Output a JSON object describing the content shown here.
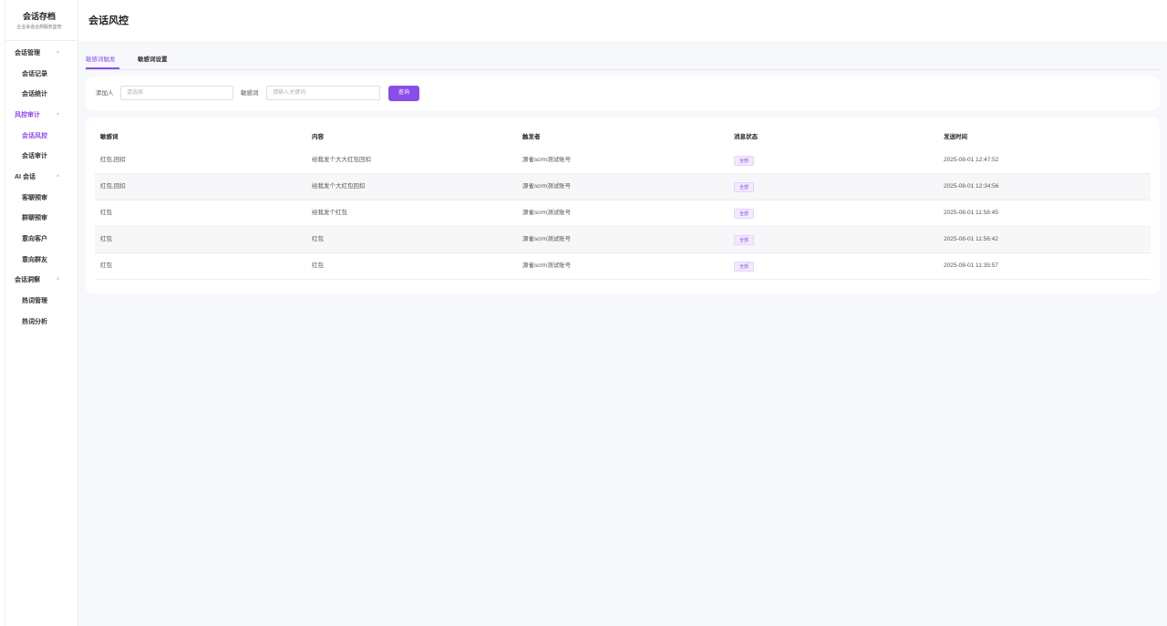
{
  "app": {
    "brand_title": "会话存档",
    "brand_subtitle": "企业会话合规服务监管"
  },
  "sidebar": {
    "groups": [
      {
        "label": "会话管理",
        "chevron": "^",
        "active": false
      },
      {
        "label": "风控审计",
        "chevron": "^",
        "active": true
      },
      {
        "label": "AI 会话",
        "chevron": "^",
        "active": false
      },
      {
        "label": "会话洞察",
        "chevron": "^",
        "active": false
      }
    ],
    "items": [
      {
        "label": "会话记录"
      },
      {
        "label": "会话统计"
      },
      {
        "label": "会话风控",
        "active": true
      },
      {
        "label": "会话审计"
      },
      {
        "label": "客聊预审"
      },
      {
        "label": "群聊预审"
      },
      {
        "label": "意向客户"
      },
      {
        "label": "意向群友"
      },
      {
        "label": "热词管理"
      },
      {
        "label": "热词分析"
      }
    ]
  },
  "header": {
    "title": "会话风控"
  },
  "tabs": [
    {
      "label": "敏感词触发",
      "active": true
    },
    {
      "label": "敏感词设置",
      "active": false
    }
  ],
  "filters": {
    "adder_label": "添加人",
    "adder_placeholder": "请选择",
    "keyword_label": "敏感词",
    "keyword_placeholder": "请输入关键词",
    "query_button": "查询"
  },
  "table": {
    "columns": [
      "敏感词",
      "内容",
      "触发者",
      "消息状态",
      "发送时间"
    ],
    "rows": [
      {
        "word": "红包,回扣",
        "content": "给我发个大大红包回扣",
        "sender": "源雀scrm测试账号",
        "status": "全部",
        "time": "2025-08-01 12:47:52"
      },
      {
        "word": "红包,回扣",
        "content": "给我发个大红包回扣",
        "sender": "源雀scrm测试账号",
        "status": "全部",
        "time": "2025-08-01 12:34:56"
      },
      {
        "word": "红包",
        "content": "给我发个红包",
        "sender": "源雀scrm测试账号",
        "status": "全部",
        "time": "2025-08-01 11:58:45"
      },
      {
        "word": "红包",
        "content": "红包",
        "sender": "源雀scrm测试账号",
        "status": "全部",
        "time": "2025-08-01 11:56:42"
      },
      {
        "word": "红包",
        "content": "红包",
        "sender": "源雀scrm测试账号",
        "status": "全部",
        "time": "2025-08-01 11:35:57"
      }
    ]
  },
  "colors": {
    "accent": "#8a4de8",
    "background": "#f7f8fc",
    "topline": "#2b63d9"
  }
}
